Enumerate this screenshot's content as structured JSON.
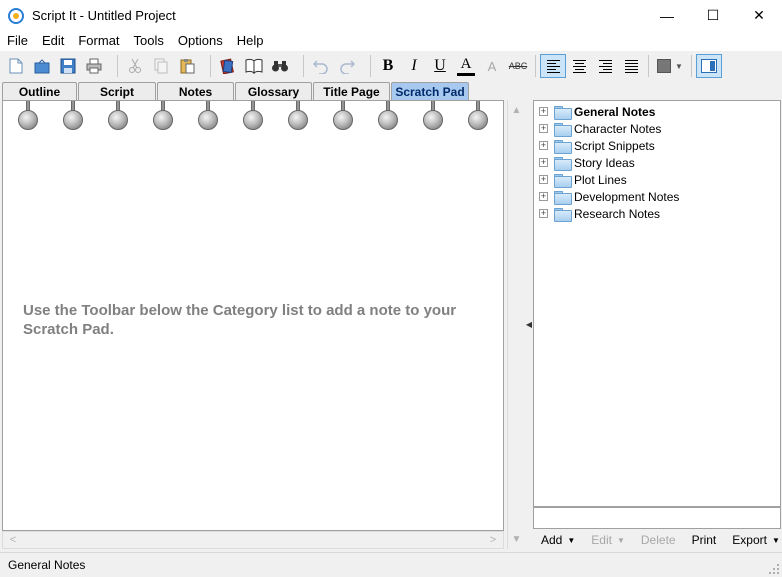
{
  "window": {
    "title": "Script It - Untitled Project",
    "controls": {
      "minimize": "—",
      "maximize": "☐",
      "close": "✕"
    }
  },
  "menu": [
    "File",
    "Edit",
    "Format",
    "Tools",
    "Options",
    "Help"
  ],
  "toolbar": {
    "icons": [
      "new-file-icon",
      "open-icon",
      "save-icon",
      "print-icon",
      "cut-icon",
      "copy-icon",
      "paste-icon",
      "spellcheck-icon",
      "book-icon",
      "binoculars-icon",
      "undo-icon",
      "redo-icon"
    ],
    "bold": "B",
    "italic": "I",
    "underline": "U",
    "font_color": "A",
    "clear_format": "A",
    "strikethrough": "ABC",
    "align_active": "align-left"
  },
  "tabs": [
    {
      "label": "Outline",
      "active": false
    },
    {
      "label": "Script",
      "active": false
    },
    {
      "label": "Notes",
      "active": false
    },
    {
      "label": "Glossary",
      "active": false
    },
    {
      "label": "Title Page",
      "active": false
    },
    {
      "label": "Scratch Pad",
      "active": true
    }
  ],
  "scratch_pad": {
    "message": "Use the Toolbar below the Category list to add a note to your Scratch Pad."
  },
  "tree": {
    "items": [
      {
        "label": "General Notes",
        "bold": true
      },
      {
        "label": "Character Notes",
        "bold": false
      },
      {
        "label": "Script Snippets",
        "bold": false
      },
      {
        "label": "Story Ideas",
        "bold": false
      },
      {
        "label": "Plot Lines",
        "bold": false
      },
      {
        "label": "Development Notes",
        "bold": false
      },
      {
        "label": "Research Notes",
        "bold": false
      }
    ],
    "expander": "+"
  },
  "tree_actions": {
    "add": "Add",
    "edit": "Edit",
    "delete": "Delete",
    "print": "Print",
    "export": "Export"
  },
  "status": {
    "text": "General Notes"
  },
  "colors": {
    "active_tab": "#a7c9f0",
    "scratch_text": "#808080",
    "folder": "#a9cfef"
  }
}
